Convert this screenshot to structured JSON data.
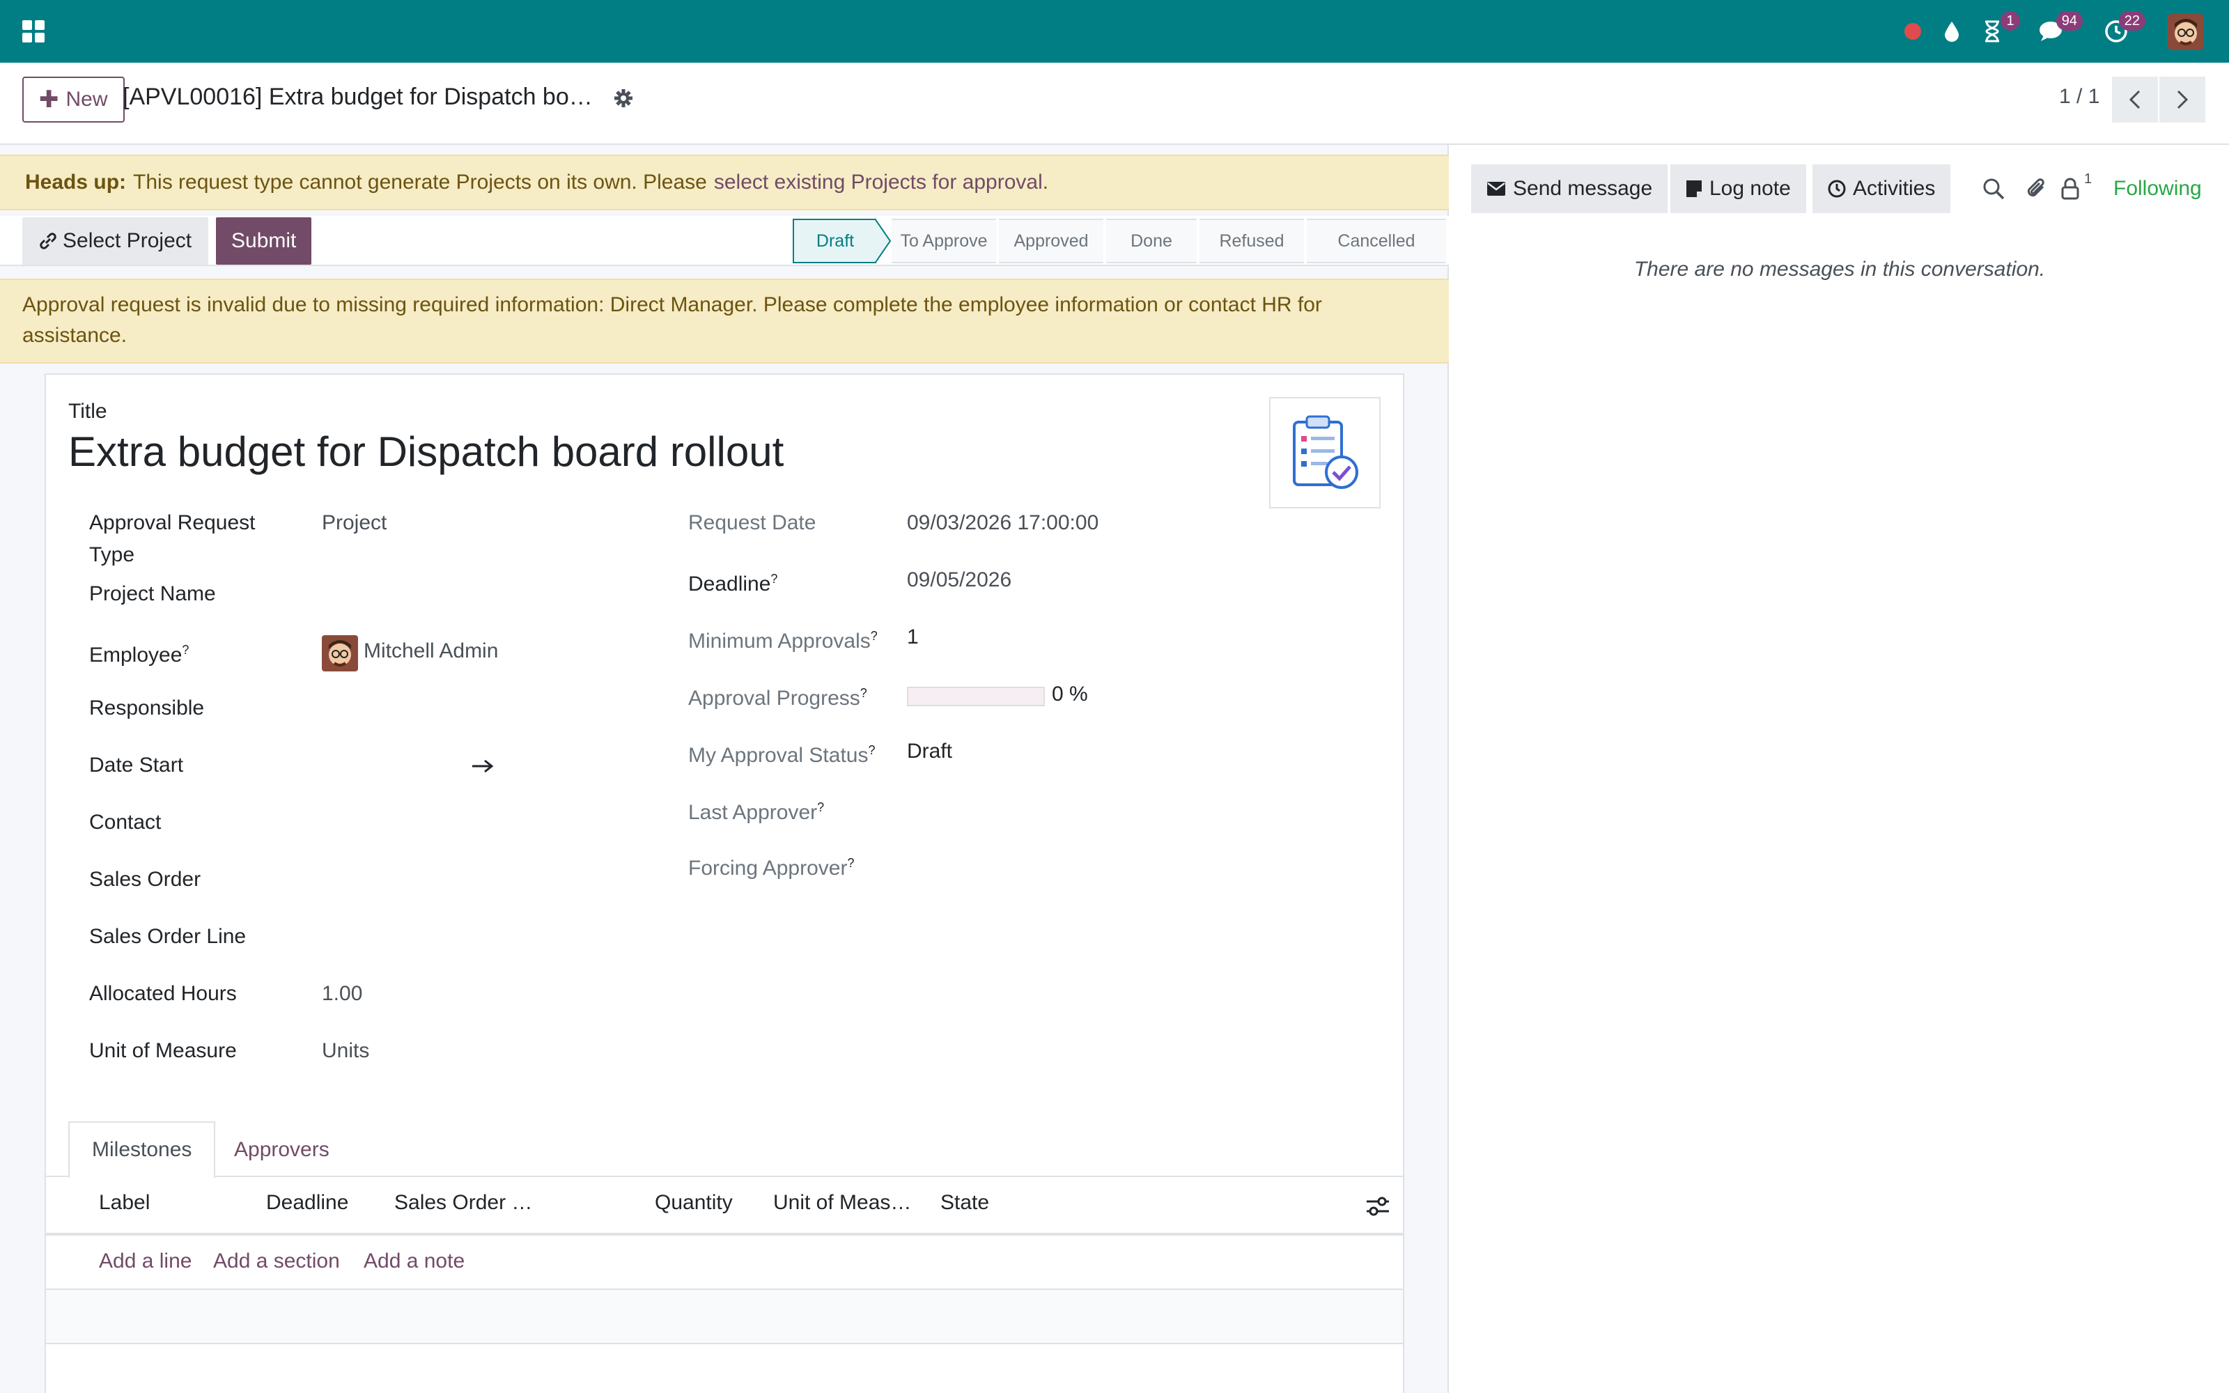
{
  "navbar": {
    "badges": {
      "activity": "1",
      "messages": "94",
      "clock": "22"
    }
  },
  "control": {
    "new_label": "New",
    "record_title": "[APVL00016] Extra budget for Dispatch bo…",
    "pager": "1 / 1"
  },
  "alert": {
    "heads_up_strong": "Heads up:",
    "heads_up_text": "This request type cannot generate Projects on its own. Please",
    "heads_up_link": "select existing Projects for approval",
    "heads_up_end": ".",
    "invalid_text": "Approval request is invalid due to missing required information: Direct Manager. Please complete the employee information or contact HR for assistance."
  },
  "statusbar": {
    "select_project": "Select Project",
    "submit": "Submit",
    "stages": [
      "Draft",
      "To Approve",
      "Approved",
      "Done",
      "Refused",
      "Cancelled"
    ],
    "active_stage": "Draft"
  },
  "form": {
    "title_label": "Title",
    "title": "Extra budget for Dispatch board rollout",
    "left_fields": [
      {
        "label": "Approval Request Type",
        "value": "Project"
      },
      {
        "label": "Project Name",
        "value": ""
      },
      {
        "label": "Employee",
        "value": "Mitchell Admin"
      },
      {
        "label": "Responsible",
        "value": ""
      },
      {
        "label": "Date Start",
        "value": ""
      },
      {
        "label": "Contact",
        "value": ""
      },
      {
        "label": "Sales Order",
        "value": ""
      },
      {
        "label": "Sales Order Line",
        "value": ""
      },
      {
        "label": "Allocated Hours",
        "value": "1.00"
      },
      {
        "label": "Unit of Measure",
        "value": "Units"
      }
    ],
    "right_fields": [
      {
        "label": "Request Date",
        "value": "09/03/2026 17:00:00"
      },
      {
        "label": "Deadline",
        "value": "09/05/2026"
      },
      {
        "label": "Minimum Approvals",
        "value": "1"
      },
      {
        "label": "Approval Progress",
        "value": "0 %",
        "progress": 0
      },
      {
        "label": "My Approval Status",
        "value": "Draft"
      },
      {
        "label": "Last Approver",
        "value": ""
      },
      {
        "label": "Forcing Approver",
        "value": ""
      }
    ],
    "help_marker": "?",
    "tabs": [
      "Milestones",
      "Approvers"
    ],
    "columns": [
      "Label",
      "Deadline",
      "Sales Order …",
      "Quantity",
      "Unit of Meas…",
      "State"
    ],
    "add_links": [
      "Add a line",
      "Add a section",
      "Add a note"
    ]
  },
  "chatter": {
    "send_message": "Send message",
    "log_note": "Log note",
    "activities": "Activities",
    "followers_count": "1",
    "following": "Following",
    "empty": "There are no messages in this conversation."
  },
  "colors": {
    "brand": "#017e84",
    "primary": "#714b67",
    "success": "#28a745",
    "warning_bg": "#f6ecc6"
  }
}
